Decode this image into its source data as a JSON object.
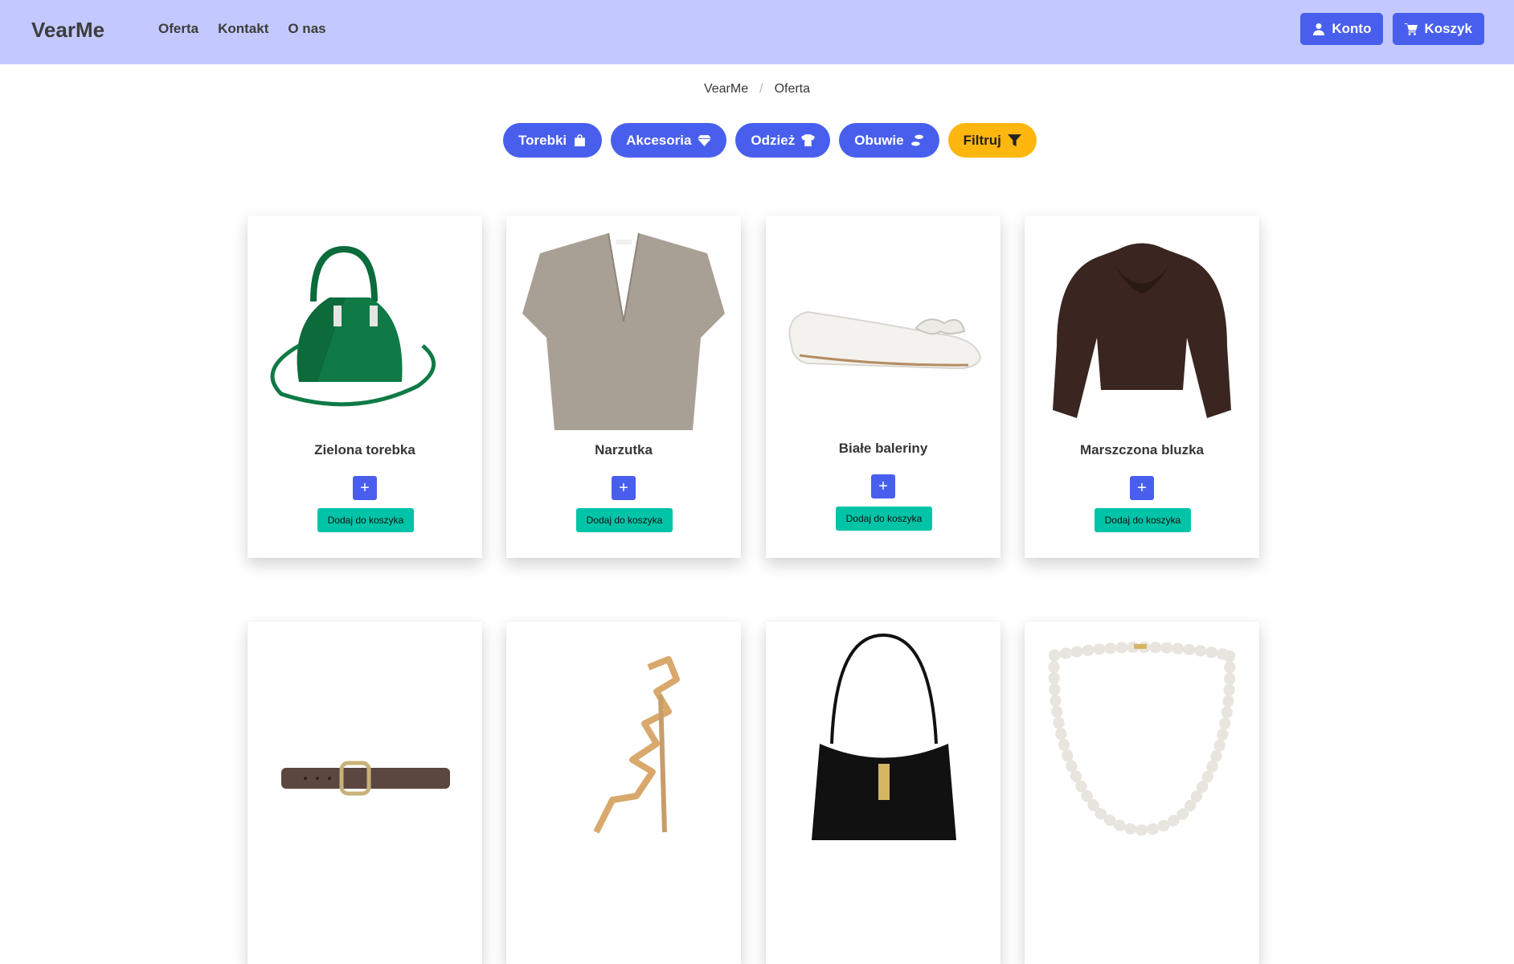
{
  "navbar": {
    "brand": "VearMe",
    "links": [
      "Oferta",
      "Kontakt",
      "O nas"
    ],
    "account_label": "Konto",
    "cart_label": "Koszyk",
    "background": "#c3c9fe"
  },
  "breadcrumb": {
    "items": [
      "VearMe",
      "Oferta"
    ]
  },
  "categories": [
    {
      "label": "Torebki",
      "icon": "bag-icon"
    },
    {
      "label": "Akcesoria",
      "icon": "diamond-icon"
    },
    {
      "label": "Odzież",
      "icon": "shirt-icon"
    },
    {
      "label": "Obuwie",
      "icon": "shoe-prints-icon"
    },
    {
      "label": "Filtruj",
      "icon": "filter-icon"
    }
  ],
  "colors": {
    "primary": "#485fee",
    "success": "#00c4a7",
    "warning": "#ffb70f"
  },
  "products": [
    {
      "title": "Zielona torebka",
      "image": "green-handbag",
      "plus_label": "+",
      "add_label": "Dodaj do koszyka"
    },
    {
      "title": "Narzutka",
      "image": "beige-poncho",
      "plus_label": "+",
      "add_label": "Dodaj do koszyka"
    },
    {
      "title": "Białe baleriny",
      "image": "white-ballerinas",
      "plus_label": "+",
      "add_label": "Dodaj do koszyka"
    },
    {
      "title": "Marszczona bluzka",
      "image": "brown-blouse",
      "plus_label": "+",
      "add_label": "Dodaj do koszyka"
    },
    {
      "title": "",
      "image": "brown-belt"
    },
    {
      "title": "",
      "image": "gold-sandal"
    },
    {
      "title": "",
      "image": "black-shoulder-bag"
    },
    {
      "title": "",
      "image": "pearl-necklace"
    }
  ]
}
